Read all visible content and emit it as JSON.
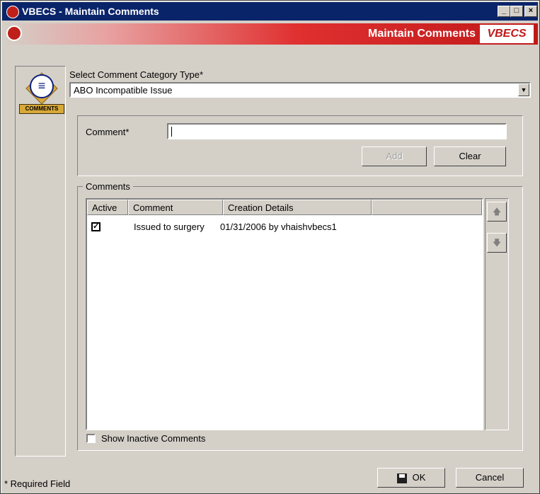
{
  "window": {
    "title": "VBECS - Maintain Comments",
    "min_btn": "_",
    "max_btn": "□",
    "close_btn": "×"
  },
  "banner": {
    "title": "Maintain Comments",
    "logo": "VBECS"
  },
  "side": {
    "icon_label": "COMMENTS"
  },
  "category": {
    "label": "Select Comment Category Type*",
    "value": "ABO Incompatible Issue"
  },
  "comment_field": {
    "label": "Comment*",
    "value": ""
  },
  "buttons": {
    "add": "Add",
    "clear": "Clear",
    "ok": "OK",
    "cancel": "Cancel"
  },
  "comments_group": {
    "title": "Comments",
    "columns": [
      "Active",
      "Comment",
      "Creation Details"
    ],
    "rows": [
      {
        "active": true,
        "comment": "Issued to surgery",
        "creation": "01/31/2006 by vhaishvbecs1"
      }
    ]
  },
  "show_inactive": {
    "label": "Show Inactive Comments",
    "checked": false
  },
  "footer": {
    "required_note": "* Required Field"
  },
  "colors": {
    "titlebar": "#0a246a",
    "banner_red": "#c01818",
    "face": "#d4d0c8"
  }
}
